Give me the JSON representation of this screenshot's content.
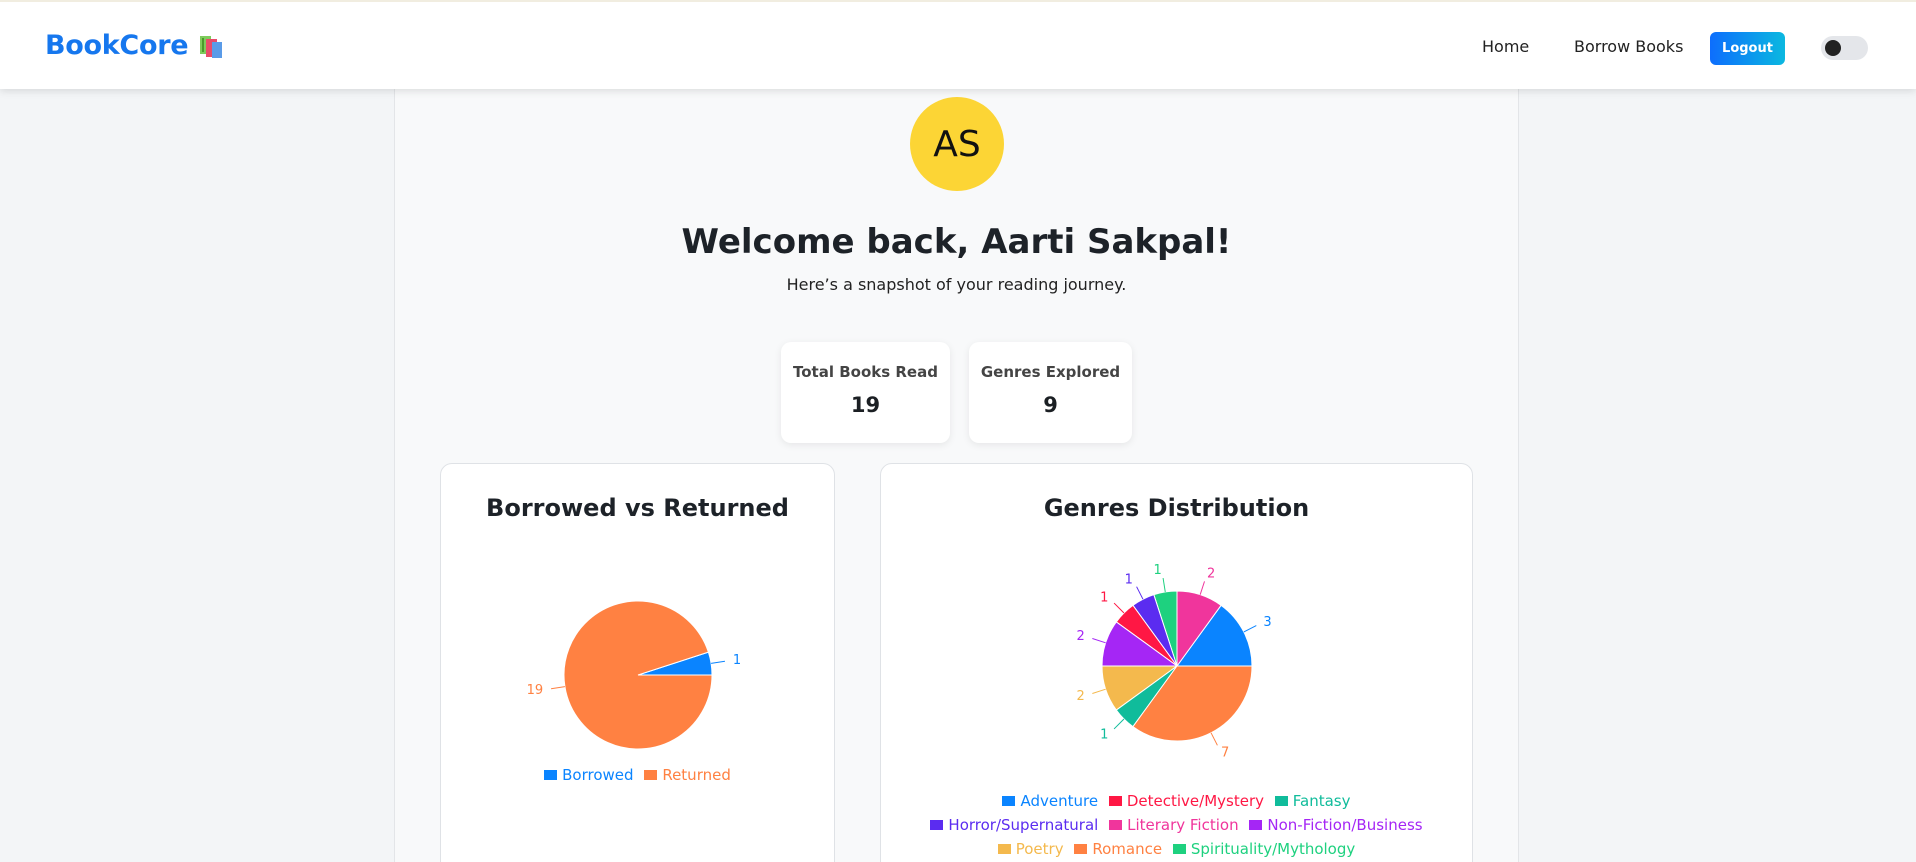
{
  "nav": {
    "brand": "BookCore",
    "home": "Home",
    "borrow": "Borrow Books",
    "logout": "Logout"
  },
  "profile": {
    "initials": "AS",
    "welcome": "Welcome back, Aarti Sakpal!",
    "subtitle": "Here’s a snapshot of your reading journey."
  },
  "stats": {
    "total_label": "Total Books Read",
    "total_value": "19",
    "genres_label": "Genres Explored",
    "genres_value": "9"
  },
  "colors": {
    "accent": "#1677ee",
    "avatar": "#fcd535"
  },
  "chart_data": [
    {
      "type": "pie",
      "title": "Borrowed vs Returned",
      "categories": [
        "Borrowed",
        "Returned"
      ],
      "values": [
        1,
        19
      ],
      "colors": [
        "#0a84ff",
        "#ff8142"
      ],
      "legend": "bottom"
    },
    {
      "type": "pie",
      "title": "Genres Distribution",
      "categories": [
        "Adventure",
        "Literary Fiction",
        "Spirituality/Mythology",
        "Horror/Supernatural",
        "Detective/Mystery",
        "Non-Fiction/Business",
        "Poetry",
        "Fantasy",
        "Romance"
      ],
      "values": [
        3,
        2,
        1,
        1,
        1,
        2,
        2,
        1,
        7
      ],
      "colors": [
        "#0a84ff",
        "#f0359c",
        "#1ed17f",
        "#5b2cf0",
        "#ff1744",
        "#a526f5",
        "#f4b94d",
        "#10bc9b",
        "#ff8142"
      ],
      "legend": "bottom"
    }
  ],
  "legends": {
    "borrow": [
      {
        "label": "Borrowed",
        "color": "#0a84ff"
      },
      {
        "label": "Returned",
        "color": "#ff8142"
      }
    ],
    "genre_rows": [
      [
        {
          "label": "Adventure",
          "color": "#0a84ff"
        },
        {
          "label": "Detective/Mystery",
          "color": "#ff1744"
        },
        {
          "label": "Fantasy",
          "color": "#10bc9b"
        }
      ],
      [
        {
          "label": "Horror/Supernatural",
          "color": "#5b2cf0"
        },
        {
          "label": "Literary Fiction",
          "color": "#f0359c"
        },
        {
          "label": "Non-Fiction/Business",
          "color": "#a526f5"
        }
      ],
      [
        {
          "label": "Poetry",
          "color": "#f4b94d"
        },
        {
          "label": "Romance",
          "color": "#ff8142"
        },
        {
          "label": "Spirituality/Mythology",
          "color": "#1ed17f"
        }
      ]
    ]
  }
}
